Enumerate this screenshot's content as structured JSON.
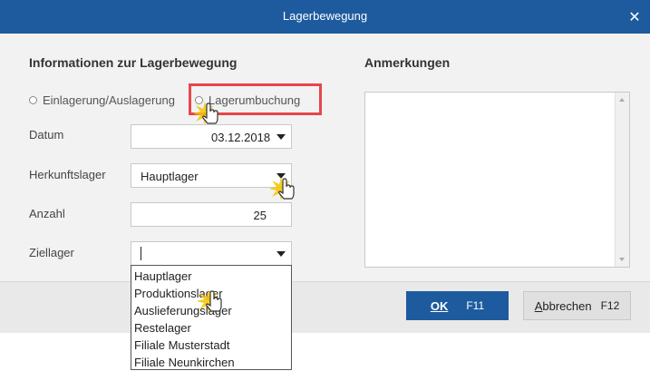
{
  "window": {
    "title": "Lagerbewegung",
    "close_icon": "close-icon"
  },
  "left_section": {
    "heading": "Informationen zur Lagerbewegung",
    "radio_options": [
      "Einlagerung/Auslagerung",
      "Lagerumbuchung"
    ],
    "fields": {
      "datum": {
        "label": "Datum",
        "value": "03.12.2018"
      },
      "herkunftslager": {
        "label": "Herkunftslager",
        "value": "Hauptlager"
      },
      "anzahl": {
        "label": "Anzahl",
        "value": "25"
      },
      "ziellager": {
        "label": "Ziellager",
        "value": ""
      }
    }
  },
  "right_section": {
    "heading": "Anmerkungen",
    "notes_value": ""
  },
  "dropdown_options": [
    "Hauptlager",
    "Produktionslager",
    "Auslieferungslager",
    "Restelager",
    "Filiale Musterstadt",
    "Filiale Neunkirchen"
  ],
  "buttons": {
    "ok": {
      "label": "OK",
      "shortcut": "F11"
    },
    "cancel": {
      "label_first": "A",
      "label_rest": "bbrechen",
      "shortcut": "F12"
    }
  },
  "colors": {
    "accent": "#1d5b9e",
    "highlight": "#e8454d"
  }
}
